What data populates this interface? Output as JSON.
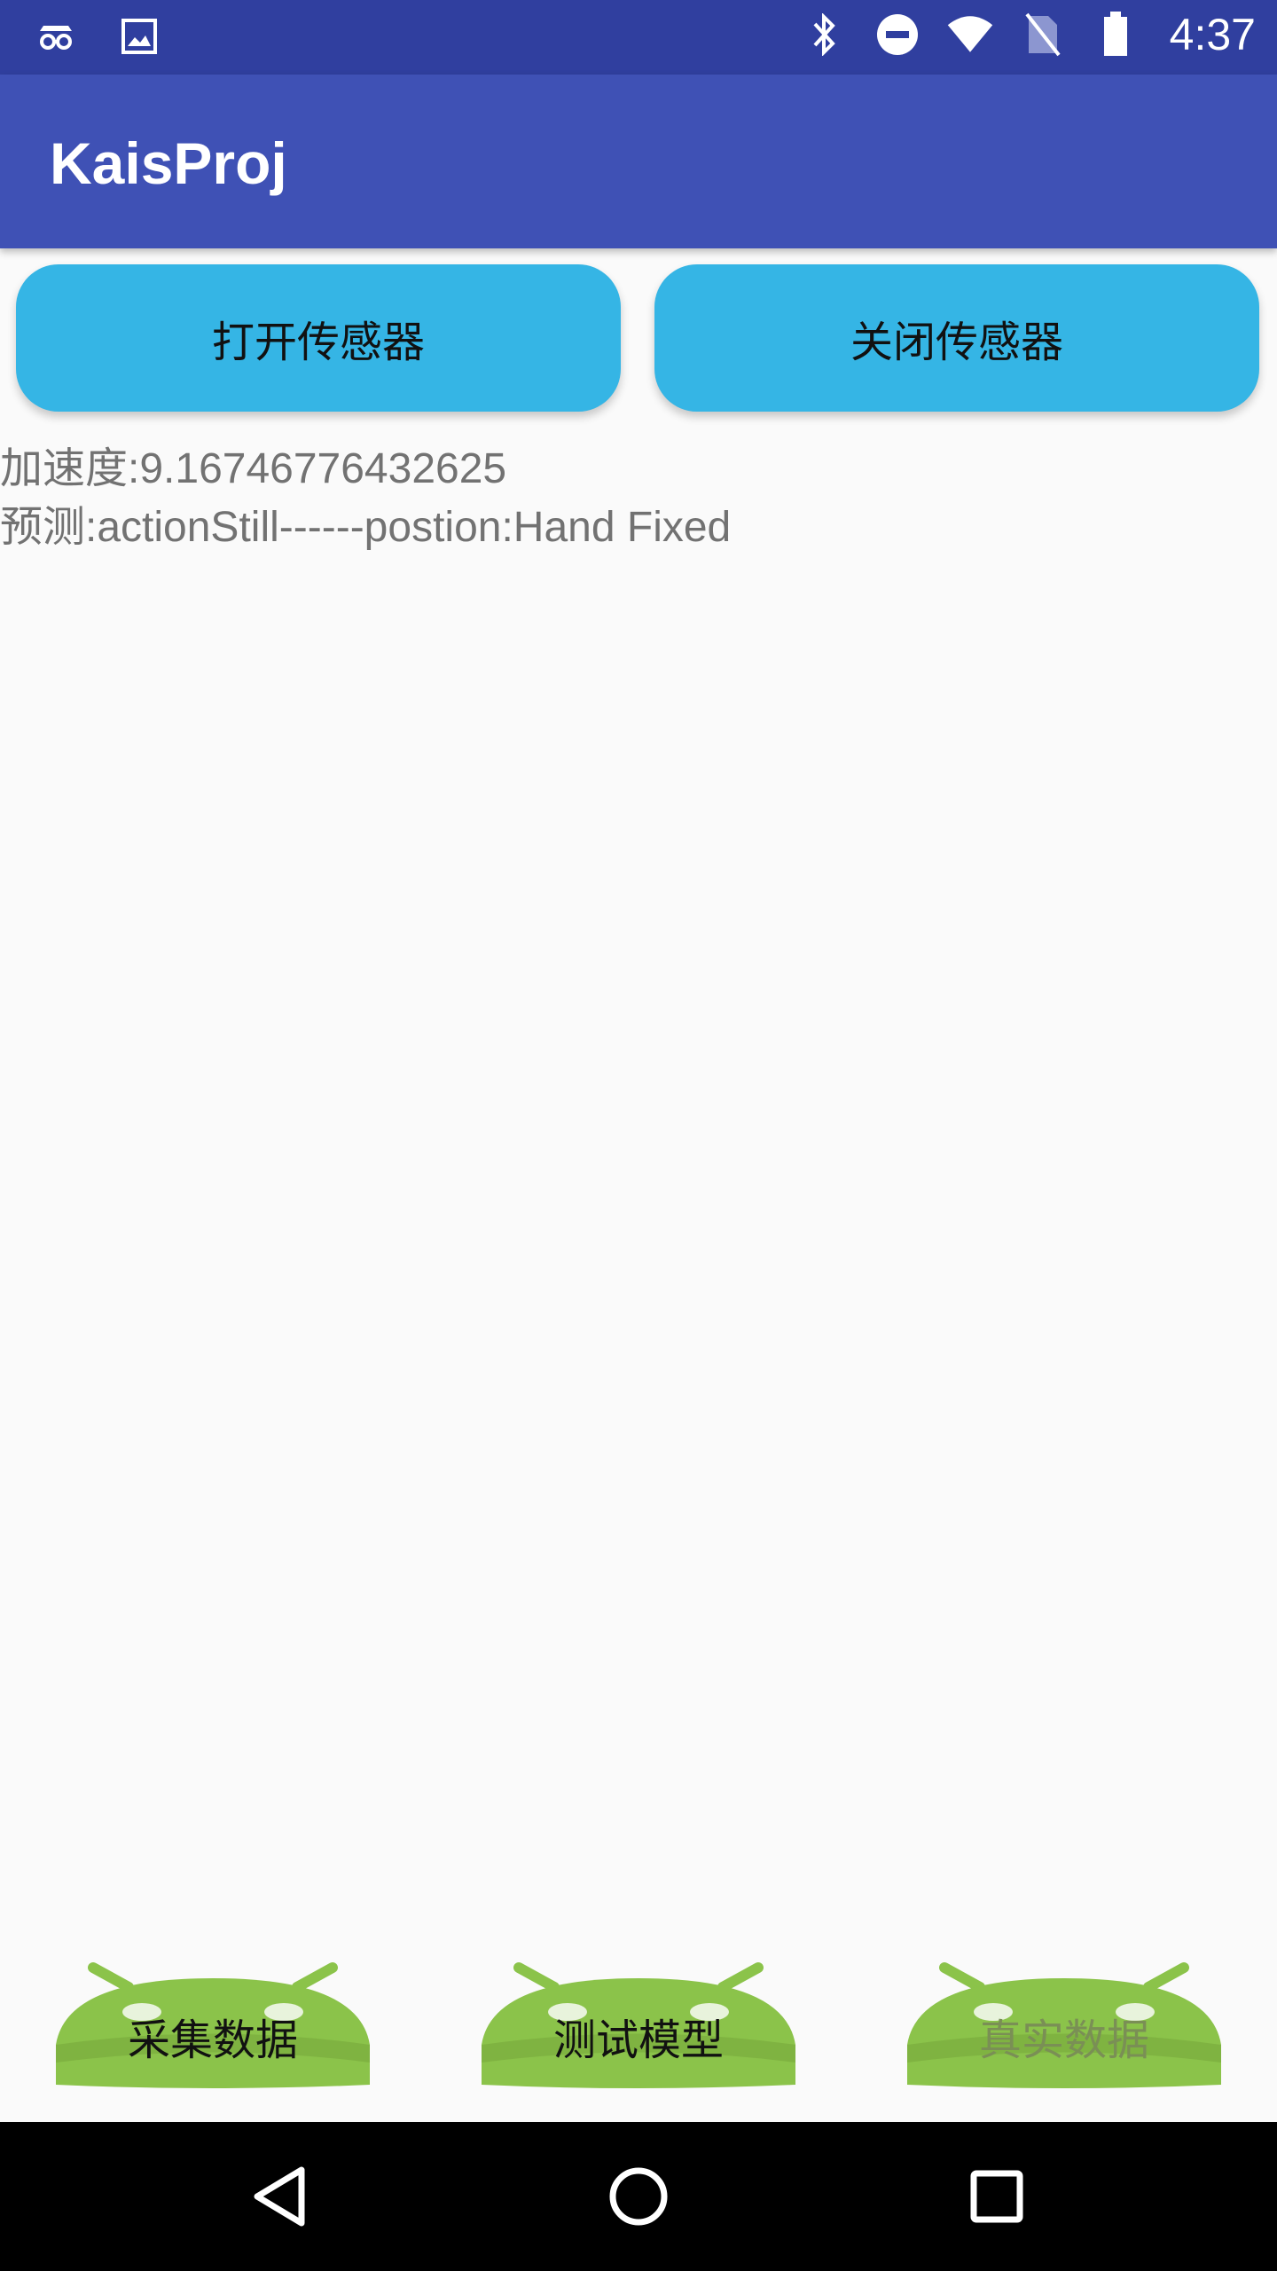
{
  "status_bar": {
    "time": "4:37",
    "icons_left": [
      "incognito-icon",
      "image-icon"
    ],
    "icons_right": [
      "bluetooth-icon",
      "do-not-disturb-icon",
      "wifi-icon",
      "no-sim-icon",
      "battery-icon"
    ]
  },
  "app_bar": {
    "title": "KaisProj"
  },
  "buttons": {
    "open_sensor": "打开传感器",
    "close_sensor": "关闭传感器"
  },
  "readings": {
    "acceleration": "加速度:9.16746776432625",
    "prediction": "预测:actionStill------postion:Hand Fixed"
  },
  "bottom_buttons": {
    "collect": "采集数据",
    "test": "测试模型",
    "real": "真实数据"
  },
  "colors": {
    "status_bar": "#303f9f",
    "app_bar": "#3f51b5",
    "top_button": "#35b5e5",
    "droid_green": "#8bc34a"
  }
}
